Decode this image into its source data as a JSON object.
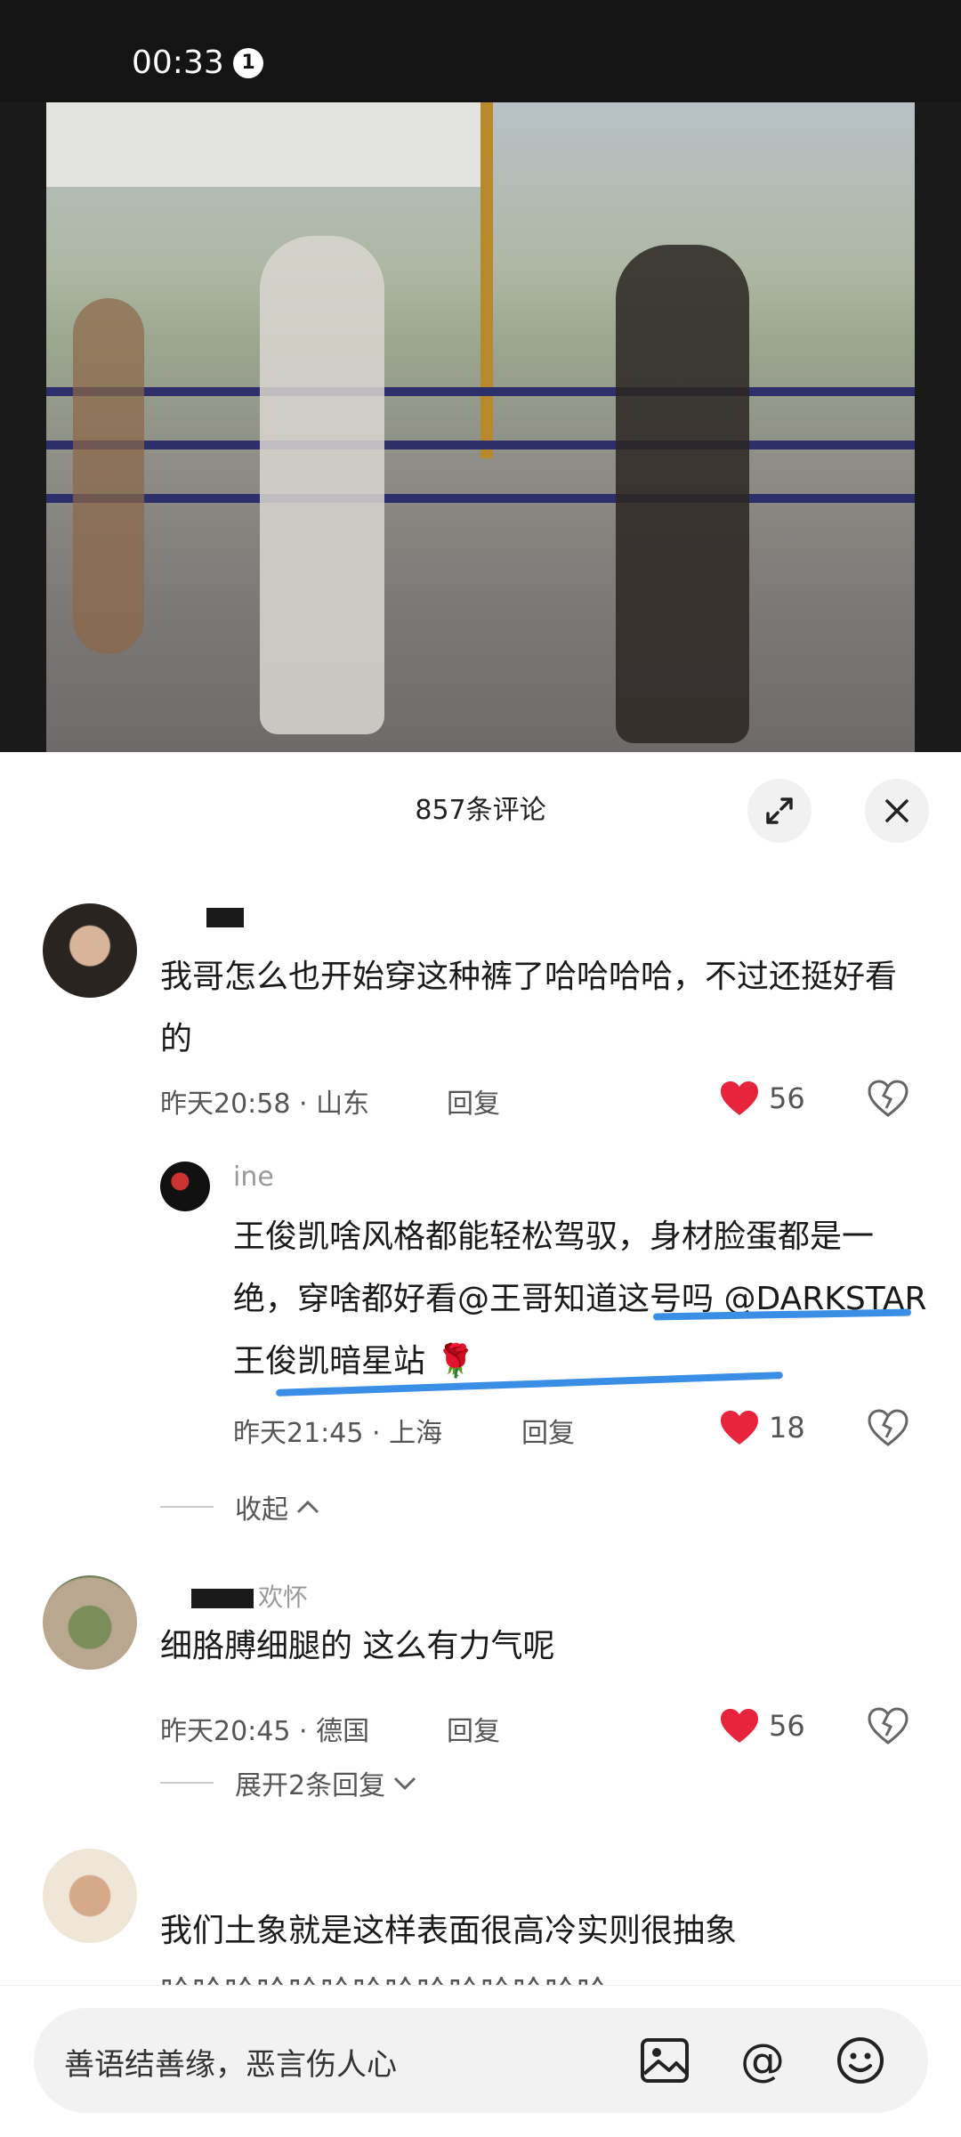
{
  "status_bar": {
    "time": "00:33",
    "notification_count": "1"
  },
  "sheet": {
    "title": "857条评论"
  },
  "comments": [
    {
      "username": "​",
      "text": "我哥怎么也开始穿这种裤了哈哈哈哈，不过还挺好看的",
      "meta": "昨天20:58 · 山东",
      "reply": "回复",
      "likes": "56",
      "replies": [
        {
          "username": "ine",
          "text_before": "王俊凯啥风格都能轻松驾驭，身材脸蛋都是一绝，穿啥都好看",
          "mention1": "@王哥知道这号吗",
          "mention2": "@DARKSTAR王俊凯暗星站",
          "emoji": "🌹",
          "meta": "昨天21:45 · 上海",
          "reply": "回复",
          "likes": "18"
        }
      ],
      "thread_toggle": "收起"
    },
    {
      "username": "欢怀",
      "text": "细胳膊细腿的 这么有力气呢",
      "meta": "昨天20:45 · 德国",
      "reply": "回复",
      "likes": "56",
      "thread_toggle": "展开2条回复"
    },
    {
      "username": "",
      "text": "我们土象就是这样表面很高冷实则很抽象",
      "text2": "哈哈哈哈哈哈哈哈哈哈哈哈哈哈"
    }
  ],
  "input": {
    "placeholder": "善语结善缘，恶言伤人心"
  },
  "colors": {
    "like_red": "#e8243c",
    "annotation_blue": "#3a8ee6"
  }
}
